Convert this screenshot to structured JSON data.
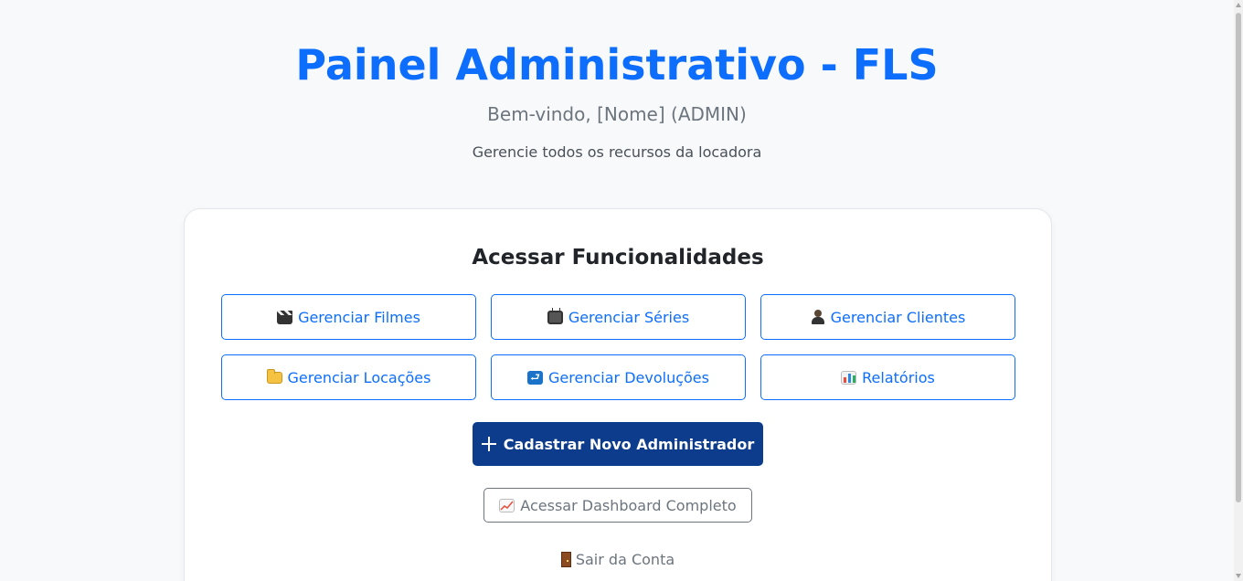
{
  "header": {
    "title": "Painel Administrativo - FLS",
    "welcome": "Bem-vindo, [Nome] (ADMIN)",
    "subtitle": "Gerencie todos os recursos da locadora"
  },
  "card": {
    "title": "Acessar Funcionalidades",
    "features": [
      {
        "label": "Gerenciar Filmes",
        "icon": "clapper-board-icon"
      },
      {
        "label": "Gerenciar Séries",
        "icon": "television-icon"
      },
      {
        "label": "Gerenciar Clientes",
        "icon": "person-icon"
      },
      {
        "label": "Gerenciar Locações",
        "icon": "folder-icon"
      },
      {
        "label": "Gerenciar Devoluções",
        "icon": "return-arrow-icon"
      },
      {
        "label": "Relatórios",
        "icon": "bar-chart-icon"
      }
    ],
    "new_admin_label": "Cadastrar Novo Administrador",
    "dashboard_label": "Acessar Dashboard Completo",
    "logout_label": "Sair da Conta"
  },
  "colors": {
    "primary": "#0d6efd",
    "dark_primary": "#0d3c8c",
    "muted": "#6c757d",
    "background": "#f8f9fb"
  }
}
